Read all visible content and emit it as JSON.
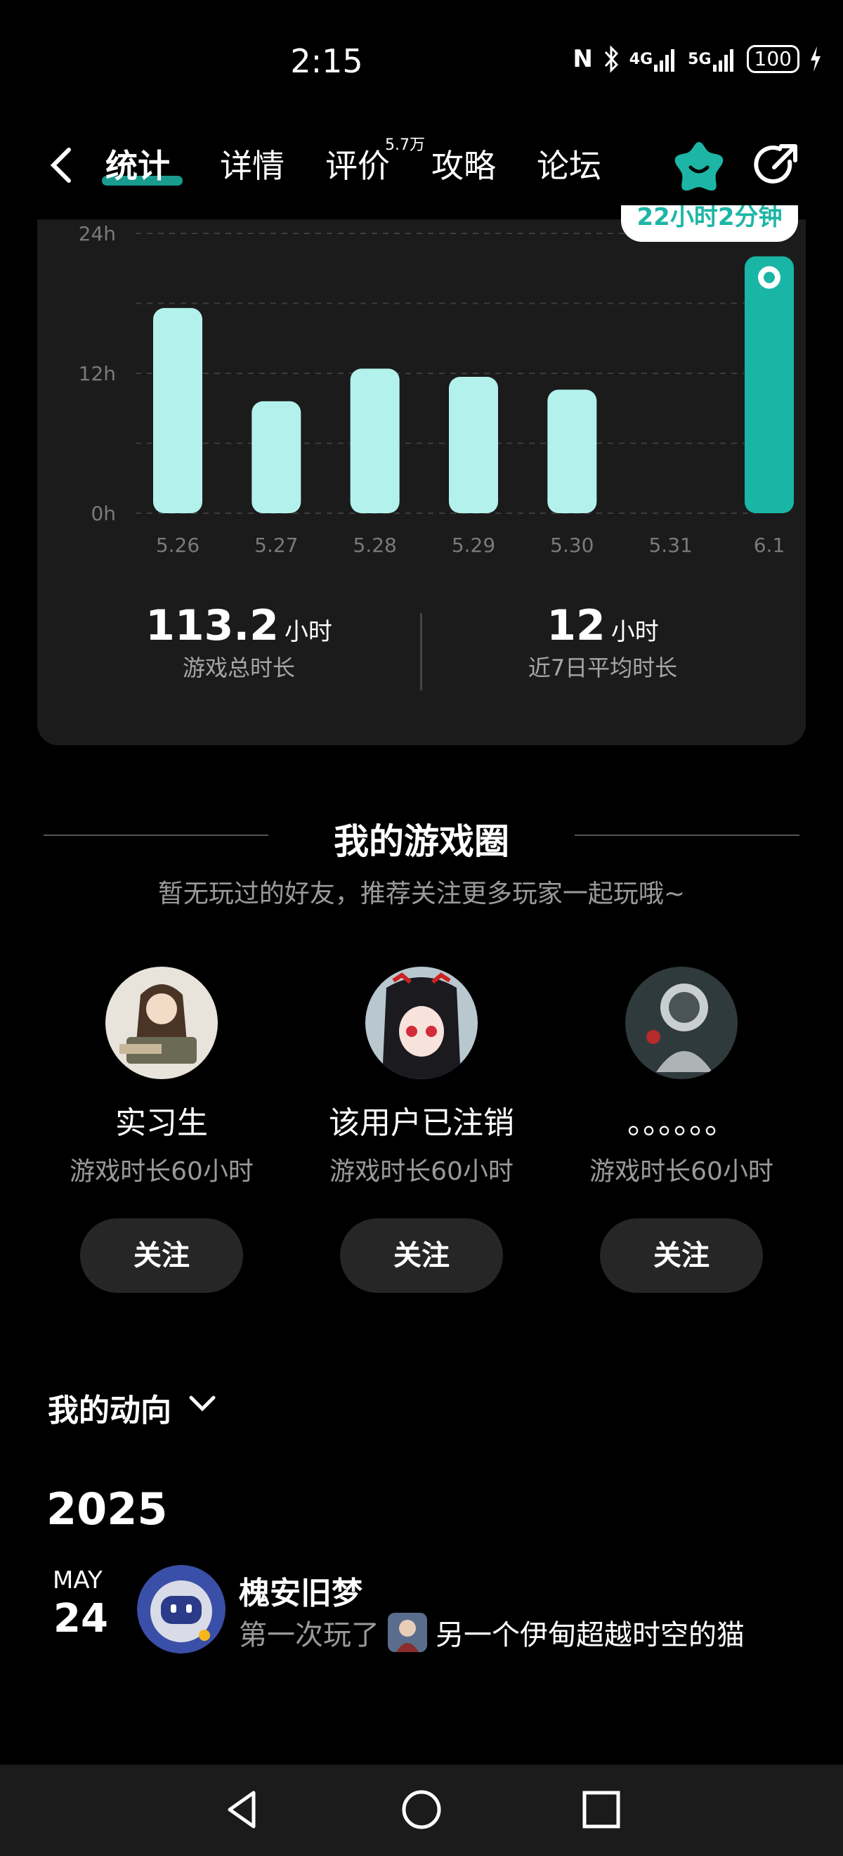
{
  "status_bar": {
    "time": "2:15",
    "nfc": "N",
    "net1": "4G",
    "net2": "5G",
    "battery": "100",
    "icons": [
      "nfc-icon",
      "bluetooth-icon",
      "signal-icon",
      "signal-icon",
      "battery-icon",
      "charging-icon"
    ]
  },
  "nav": {
    "tabs": [
      {
        "label": "统计"
      },
      {
        "label": "详情"
      },
      {
        "label": "评价"
      },
      {
        "label": "攻略"
      },
      {
        "label": "论坛"
      }
    ],
    "review_count": "5.7万",
    "accent": "#1db6a6"
  },
  "chart": {
    "tooltip": "22小时2分钟"
  },
  "chart_data": {
    "type": "bar",
    "categories": [
      "5.26",
      "5.27",
      "5.28",
      "5.29",
      "5.30",
      "5.31",
      "6.1"
    ],
    "values": [
      17.6,
      9.6,
      12.4,
      11.7,
      10.6,
      0,
      22.03
    ],
    "y_tick_labels": [
      "0h",
      "12h",
      "24h"
    ],
    "ylim": [
      0,
      24
    ],
    "grid": true,
    "highlight_category": "6.1",
    "colors": {
      "normal": "#b3f2ec",
      "highlight": "#19b6a5"
    }
  },
  "stats": {
    "total": {
      "value": "113.2",
      "unit": "小时",
      "label": "游戏总时长"
    },
    "avg": {
      "value": "12",
      "unit": "小时",
      "label": "近7日平均时长"
    }
  },
  "circle": {
    "title": "我的游戏圈",
    "subtitle": "暂无玩过的好友，推荐关注更多玩家一起玩哦~",
    "users": [
      {
        "name": "实习生",
        "meta": "游戏时长60小时",
        "follow": "关注"
      },
      {
        "name": "该用户已注销",
        "meta": "游戏时长60小时",
        "follow": "关注"
      },
      {
        "name": "。。。。。。",
        "meta": "游戏时长60小时",
        "follow": "关注"
      }
    ]
  },
  "activity": {
    "title": "我的动向",
    "year": "2025",
    "month": "MAY",
    "day": "24",
    "user": "槐安旧梦",
    "prefix": "第一次玩了",
    "game": "另一个伊甸超越时空的猫"
  }
}
